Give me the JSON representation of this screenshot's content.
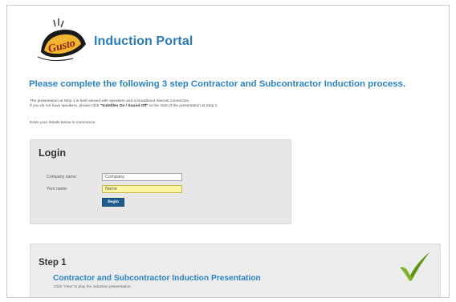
{
  "header": {
    "logo_text": "Gusto",
    "portal_title": "Induction Portal"
  },
  "intro": {
    "headline": "Please complete the following 3 step Contractor and Subcontractor Induction process.",
    "line1": "The presentation at Step 1 is best viewed with speakers and a broadband internet connection.",
    "line2_prefix": "If you do not have speakers, please click ",
    "line2_bold": "\"Subtitles On / Sound Off\"",
    "line2_suffix": " at the start of the presentation at Step 1.",
    "enter_details": "Enter your details below to commence."
  },
  "login": {
    "heading": "Login",
    "company_label": "Company name:",
    "company_value": "Company",
    "name_label": "Your name:",
    "name_value": "Name",
    "begin_label": "Begin"
  },
  "step1": {
    "title": "Step 1",
    "link_text": "Contractor and Subcontractor Induction Presentation",
    "note": "Click 'View' to play the induction presentation."
  },
  "colors": {
    "accent": "#2b83c0",
    "button": "#1c5d8c",
    "name_field": "#fbf6a3",
    "check": "#7fb22a"
  }
}
